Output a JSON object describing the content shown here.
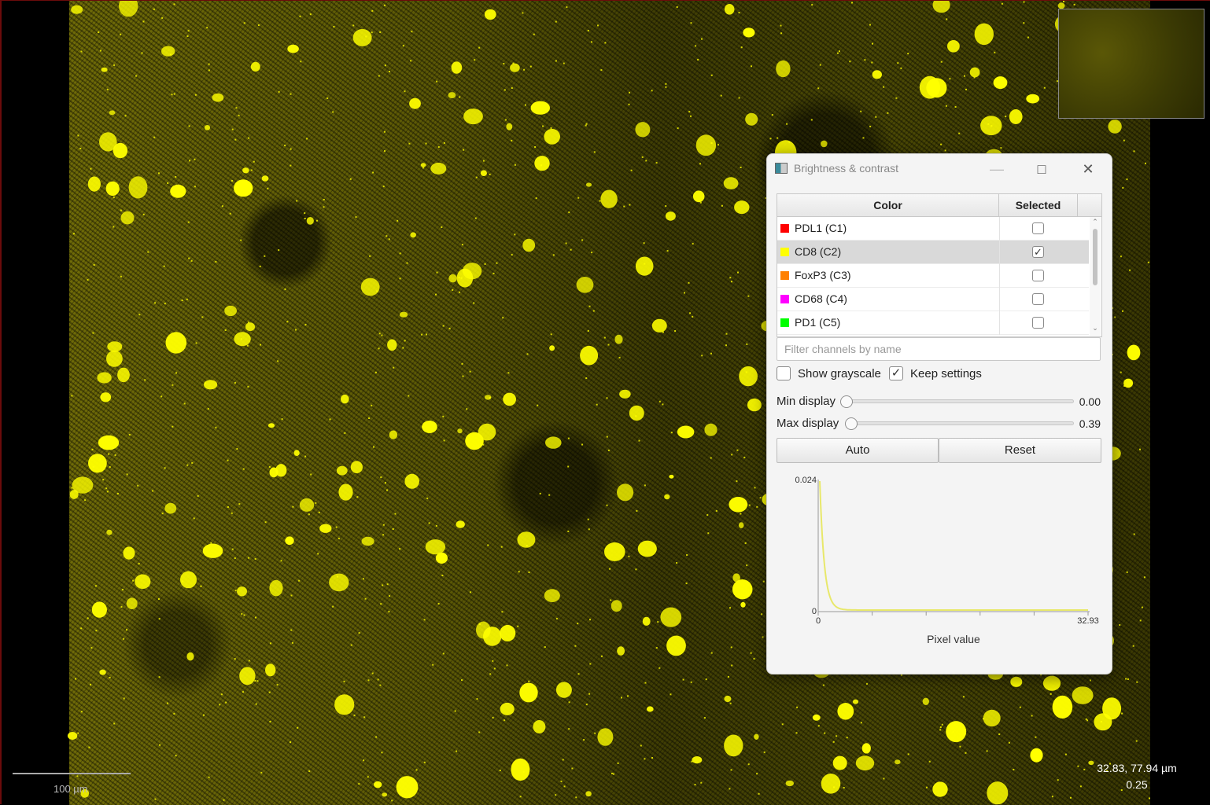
{
  "dialog": {
    "title": "Brightness & contrast",
    "table": {
      "headers": {
        "color": "Color",
        "selected": "Selected"
      },
      "channels": [
        {
          "name": "PDL1 (C1)",
          "color": "#ff0000",
          "selected": false
        },
        {
          "name": "CD8 (C2)",
          "color": "#ffff00",
          "selected": true
        },
        {
          "name": "FoxP3 (C3)",
          "color": "#ff8000",
          "selected": false
        },
        {
          "name": "CD68 (C4)",
          "color": "#ff00ff",
          "selected": false
        },
        {
          "name": "PD1 (C5)",
          "color": "#00ff00",
          "selected": false
        }
      ]
    },
    "filter": {
      "placeholder": "Filter channels by name",
      "value": ""
    },
    "options": {
      "show_grayscale": {
        "label": "Show grayscale",
        "checked": false
      },
      "keep_settings": {
        "label": "Keep settings",
        "checked": true
      }
    },
    "sliders": {
      "min": {
        "label": "Min display",
        "value": "0.00",
        "level": 0.0
      },
      "max": {
        "label": "Max display",
        "value": "0.39",
        "level": 0.012
      }
    },
    "buttons": {
      "auto": "Auto",
      "reset": "Reset"
    },
    "histogram": {
      "y_max_label": "0.024",
      "y_min_label": "0",
      "x_min_label": "0",
      "x_max_label": "32.93",
      "xlabel": "Pixel value",
      "color": "#e8e86a"
    }
  },
  "viewer": {
    "scalebar_label": "100 µm",
    "cursor_coords": "32.83, 77.94 µm",
    "cursor_value": "0.25",
    "marker_color": "#ffff00"
  }
}
